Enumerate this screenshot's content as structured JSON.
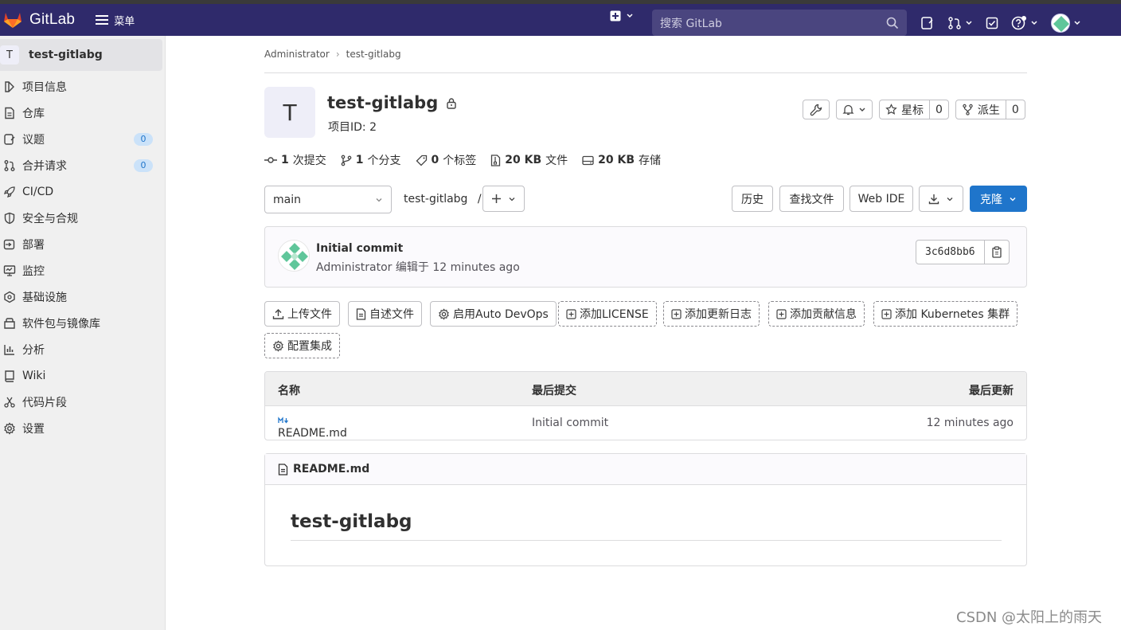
{
  "topbar": {
    "brand": "GitLab",
    "menu_label": "菜单",
    "search_placeholder": "搜索 GitLab"
  },
  "sidebar": {
    "project_initial": "T",
    "project_name": "test-gitlabg",
    "items": [
      {
        "label": "项目信息",
        "icon": "info-icon"
      },
      {
        "label": "仓库",
        "icon": "doc-icon"
      },
      {
        "label": "议题",
        "icon": "issues-icon",
        "badge": "0"
      },
      {
        "label": "合并请求",
        "icon": "merge-request-icon",
        "badge": "0"
      },
      {
        "label": "CI/CD",
        "icon": "rocket-icon"
      },
      {
        "label": "安全与合规",
        "icon": "shield-icon"
      },
      {
        "label": "部署",
        "icon": "deploy-icon"
      },
      {
        "label": "监控",
        "icon": "monitor-icon"
      },
      {
        "label": "基础设施",
        "icon": "cloud-gear-icon"
      },
      {
        "label": "软件包与镜像库",
        "icon": "package-icon"
      },
      {
        "label": "分析",
        "icon": "chart-icon"
      },
      {
        "label": "Wiki",
        "icon": "book-icon"
      },
      {
        "label": "代码片段",
        "icon": "scissors-icon"
      },
      {
        "label": "设置",
        "icon": "gear-icon"
      }
    ]
  },
  "breadcrumb": [
    "Administrator",
    "test-gitlabg"
  ],
  "project": {
    "initial": "T",
    "title": "test-gitlabg",
    "id_text": "项目ID: 2",
    "star_label": "星标",
    "star_count": "0",
    "fork_label": "派生",
    "fork_count": "0"
  },
  "stats": [
    {
      "value": "1",
      "label": "次提交"
    },
    {
      "value": "1",
      "label": "个分支"
    },
    {
      "value": "0",
      "label": "个标签"
    },
    {
      "value": "20 KB",
      "label": "文件"
    },
    {
      "value": "20 KB",
      "label": "存储"
    }
  ],
  "toolbar": {
    "branch": "main",
    "path": "test-gitlabg",
    "path_sep": "/",
    "history": "历史",
    "find_file": "查找文件",
    "web_ide": "Web IDE",
    "clone": "克隆"
  },
  "commit": {
    "title": "Initial commit",
    "author": "Administrator",
    "meta_suffix": "编辑于 12 minutes ago",
    "sha": "3c6d8bb6"
  },
  "quick_actions": [
    "上传文件",
    "自述文件",
    "启用Auto DevOps",
    "添加LICENSE",
    "添加更新日志",
    "添加贡献信息",
    "添加 Kubernetes 集群",
    "配置集成"
  ],
  "file_table": {
    "headers": [
      "名称",
      "最后提交",
      "最后更新"
    ],
    "rows": [
      {
        "name": "README.md",
        "commit": "Initial commit",
        "updated": "12 minutes ago"
      }
    ]
  },
  "readme": {
    "file": "README.md",
    "heading": "test-gitlabg"
  },
  "watermark": "CSDN @太阳上的雨天",
  "colors": {
    "topbar": "#2f2a6b",
    "primary": "#1f75cb"
  }
}
